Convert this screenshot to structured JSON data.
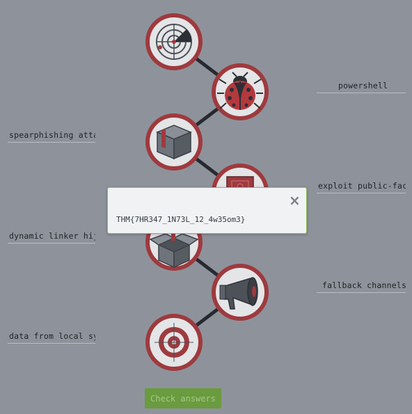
{
  "answers": [
    {
      "label": "powershell"
    },
    {
      "label": "spearphishing attac"
    },
    {
      "label": "exploit public-faci"
    },
    {
      "label": "dynamic linker hija"
    },
    {
      "label": "fallback channels"
    },
    {
      "label": "data from local sys"
    }
  ],
  "icons": [
    "radar-icon",
    "ladybug-icon",
    "box-icon",
    "document-icon",
    "open-box-icon",
    "megaphone-icon",
    "target-icon"
  ],
  "colors": {
    "background": "#8e939b",
    "ring": "#9e3a3e",
    "connector": "#262a30",
    "button": "#6a9b3e",
    "modal_border": "#8fbe52"
  },
  "check_button": {
    "label": "Check answers"
  },
  "modal": {
    "close_symbol": "×",
    "flag": "THM{7HR347_1N73L_12_4w35om3}"
  }
}
